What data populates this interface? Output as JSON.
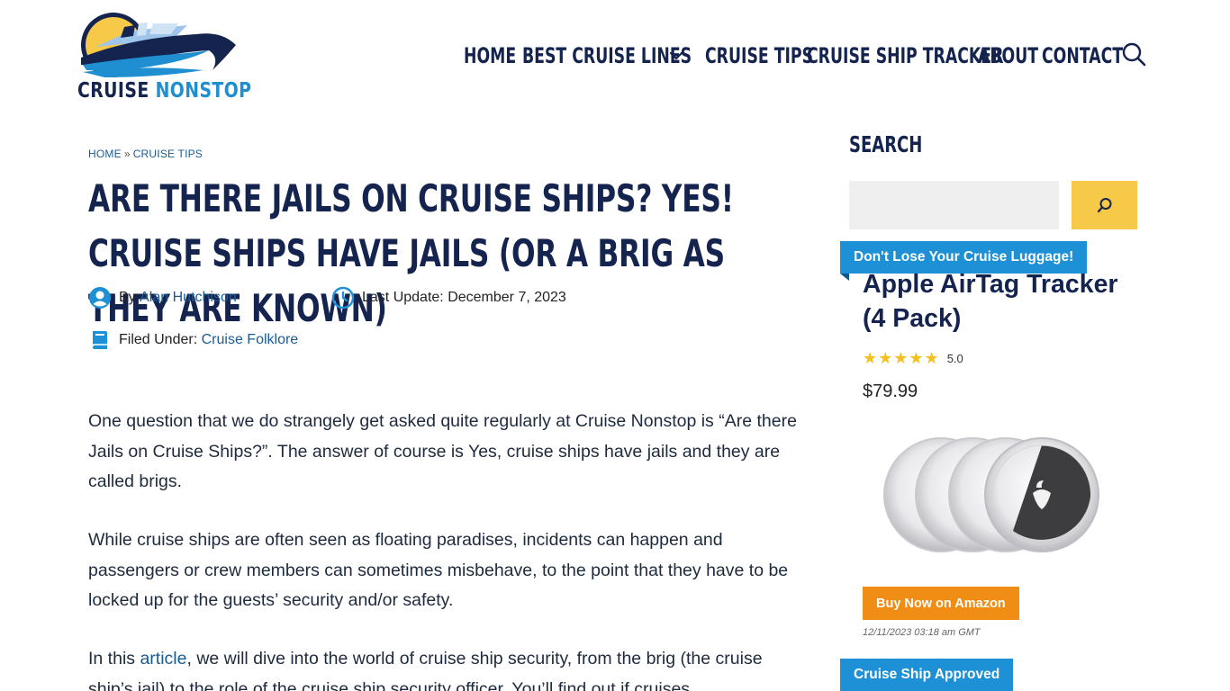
{
  "brand": {
    "name_part1": "CRUISE",
    "name_part2": "NONSTOP",
    "logo_icon": "cruise-ship-logo",
    "colors": {
      "navy": "#14244f",
      "blue": "#1f8fd1",
      "sun": "#f7c948"
    }
  },
  "nav": {
    "items": [
      {
        "label": "HOME"
      },
      {
        "label": "BEST CRUISE LINES",
        "has_dropdown": true
      },
      {
        "label": "CRUISE TIPS"
      },
      {
        "label": "CRUISE SHIP TRACKER"
      },
      {
        "label": "ABOUT"
      },
      {
        "label": "CONTACT"
      }
    ],
    "search_icon": "search-icon"
  },
  "breadcrumb": {
    "home": "HOME",
    "separator": "»",
    "current": "CRUISE TIPS"
  },
  "article": {
    "title": "Are There Jails on Cruise Ships? YES! Cruise Ships Have Jails (or a Brig as they are known)",
    "author_prefix": "By",
    "author": "Alan Hutchison",
    "updated_label": "Last Update:",
    "updated_date": "December 7, 2023",
    "filed_label": "Filed Under:",
    "category": "Cruise Folklore",
    "p1": "One question that we do strangely get asked quite regularly at Cruise Nonstop is “Are there Jails on Cruise Ships?”.  The answer of course is Yes, cruise ships have jails and they are called brigs.",
    "p2": "While cruise ships are often seen as floating paradises, incidents can happen and passengers or crew members can sometimes misbehave, to the point that they have to be locked up for the guests’ security and/or safety.",
    "p3_before": "In this ",
    "p3_link": "article",
    "p3_after": ", we will dive into the world of cruise ship security, from the brig (the cruise ship’s jail) to the role of the cruise ship security officer. You’ll find out if cruises"
  },
  "sidebar": {
    "search_title": "SEARCH",
    "search_placeholder": "",
    "ribbon1": "Don't Lose Your Cruise Luggage!",
    "product": {
      "title": "Apple AirTag Tracker (4 Pack)",
      "stars": "★★★★★",
      "rating": "5.0",
      "rating_value": 5.0,
      "price": "$79.99",
      "buy_label": "Buy Now on Amazon",
      "timestamp": "12/11/2023 03:18 am GMT"
    },
    "ribbon2": "Cruise Ship Approved"
  }
}
